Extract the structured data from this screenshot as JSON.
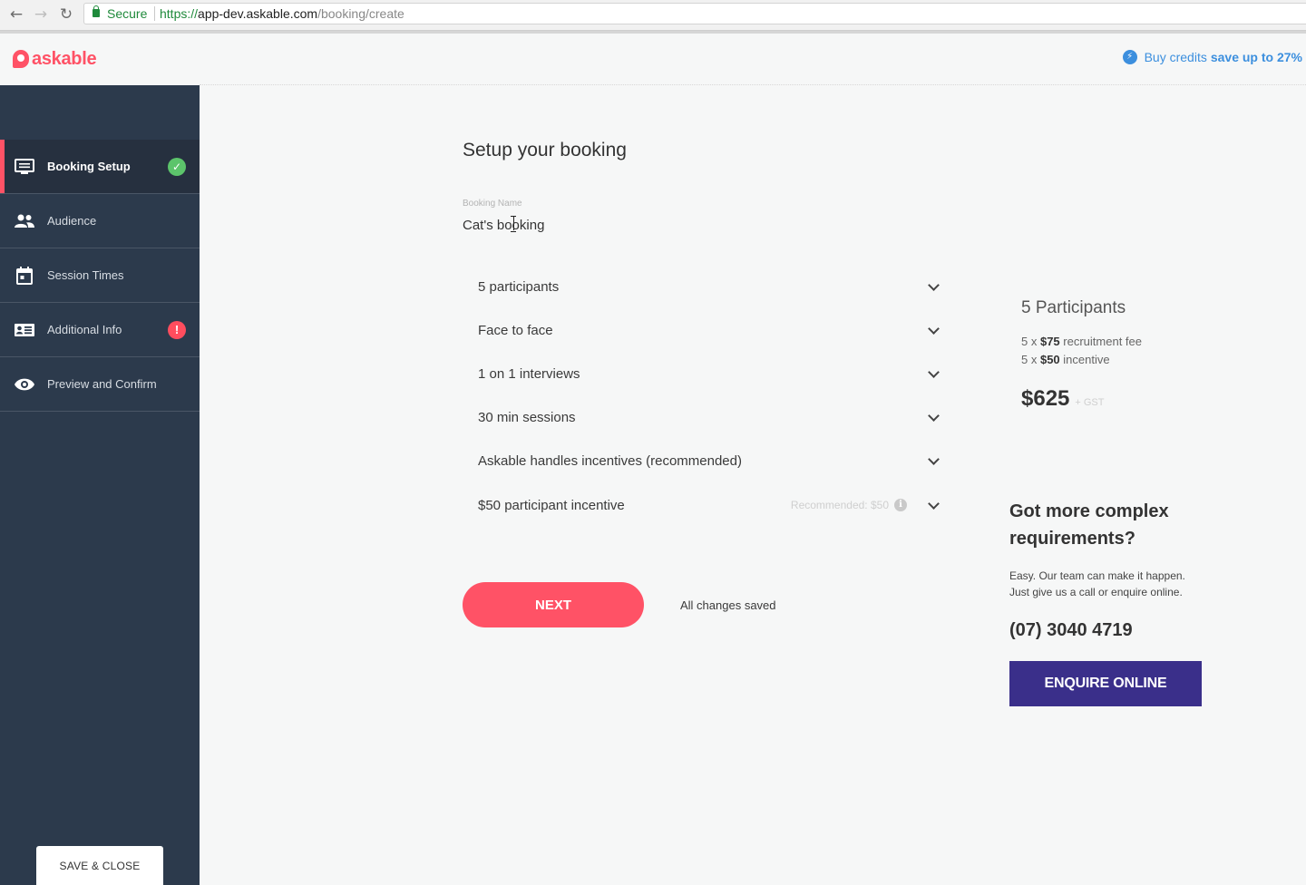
{
  "browser": {
    "back_icon": "←",
    "forward_icon": "→",
    "reload_icon": "↻",
    "secure_label": "Secure",
    "url_proto": "https://",
    "url_host": "app-dev.askable.com",
    "url_path": "/booking/create"
  },
  "header": {
    "logo_text": "askable",
    "credits_text": "Buy credits",
    "credits_emphasis": "save up to 27%"
  },
  "sidebar": {
    "items": [
      {
        "label": "Booking Setup",
        "icon": "booking-setup-icon",
        "status": "complete",
        "status_glyph": "✓"
      },
      {
        "label": "Audience",
        "icon": "audience-icon"
      },
      {
        "label": "Session Times",
        "icon": "calendar-icon"
      },
      {
        "label": "Additional Info",
        "icon": "id-card-icon",
        "status": "warning",
        "status_glyph": "!"
      },
      {
        "label": "Preview and Confirm",
        "icon": "eye-icon"
      }
    ],
    "save_close_label": "SAVE & CLOSE"
  },
  "main": {
    "title": "Setup your booking",
    "booking_name_label": "Booking Name",
    "booking_name_value": "Cat's booking",
    "options": [
      {
        "label": "5 participants"
      },
      {
        "label": "Face to face"
      },
      {
        "label": "1 on 1 interviews"
      },
      {
        "label": "30 min sessions"
      },
      {
        "label": "Askable handles incentives (recommended)"
      },
      {
        "label": "$50 participant incentive",
        "recommended": "Recommended: $50",
        "info_glyph": "i"
      }
    ],
    "next_label": "NEXT",
    "saved_status": "All changes saved"
  },
  "summary": {
    "title": "5 Participants",
    "recruitment_qty": "5 x ",
    "recruitment_price": "$75",
    "recruitment_label": " recruitment fee",
    "incentive_qty": "5 x ",
    "incentive_price": "$50",
    "incentive_label": " incentive",
    "total": "$625",
    "gst": "+ GST"
  },
  "complex": {
    "title": "Got more complex requirements?",
    "text_line1": "Easy. Our team can make it happen.",
    "text_line2": "Just give us a call or enquire online.",
    "phone": "(07) 3040 4719",
    "enquire_label": "ENQUIRE ONLINE"
  },
  "colors": {
    "brand": "#ff5266",
    "sidebar_bg": "#2c3a4c",
    "enquire_bg": "#3a2f8a",
    "link": "#3c8fde",
    "success": "#5cc46b",
    "warning": "#ff4d5e"
  }
}
